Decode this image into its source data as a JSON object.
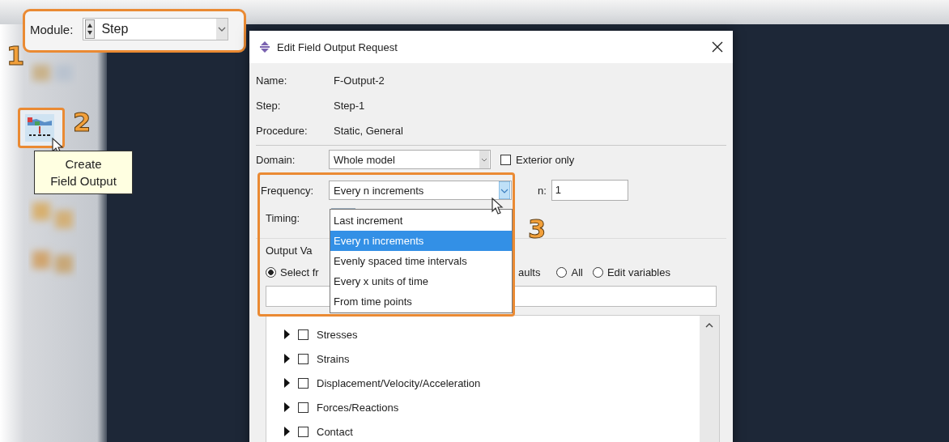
{
  "module_selector": {
    "label": "Module:",
    "value": "Step"
  },
  "annotations": [
    {
      "number": "1"
    },
    {
      "number": "2"
    },
    {
      "number": "3"
    }
  ],
  "tooltip": {
    "lines": [
      "Create",
      "Field Output"
    ]
  },
  "dialog": {
    "title": "Edit Field Output Request",
    "info": [
      {
        "label": "Name:",
        "value": "F-Output-2"
      },
      {
        "label": "Step:",
        "value": "Step-1"
      },
      {
        "label": "Procedure:",
        "value": "Static, General"
      }
    ],
    "domain": {
      "label": "Domain:",
      "value": "Whole model"
    },
    "exterior_only": {
      "label": "Exterior only",
      "checked": false
    },
    "frequency": {
      "label": "Frequency:",
      "value": "Every n increments",
      "n_label": "n:",
      "n_value": "1"
    },
    "timing": {
      "label": "Timing:"
    },
    "frequency_options": [
      {
        "label": "Last increment",
        "selected": false
      },
      {
        "label": "Every n increments",
        "selected": true
      },
      {
        "label": "Evenly spaced time intervals",
        "selected": false
      },
      {
        "label": "Every x units of time",
        "selected": false
      },
      {
        "label": "From time points",
        "selected": false
      }
    ],
    "output_variables_label": "Output Va",
    "radio_fragment": "aults",
    "radios": [
      {
        "label": "Select fr",
        "selected": true
      }
    ],
    "radios_after_fragment": [
      {
        "label": "All",
        "selected": false
      },
      {
        "label": "Edit variables",
        "selected": false
      }
    ],
    "variables": [
      {
        "label": "Stresses",
        "checked": false
      },
      {
        "label": "Strains",
        "checked": false
      },
      {
        "label": "Displacement/Velocity/Acceleration",
        "checked": false
      },
      {
        "label": "Forces/Reactions",
        "checked": false
      },
      {
        "label": "Contact",
        "checked": false
      }
    ]
  }
}
